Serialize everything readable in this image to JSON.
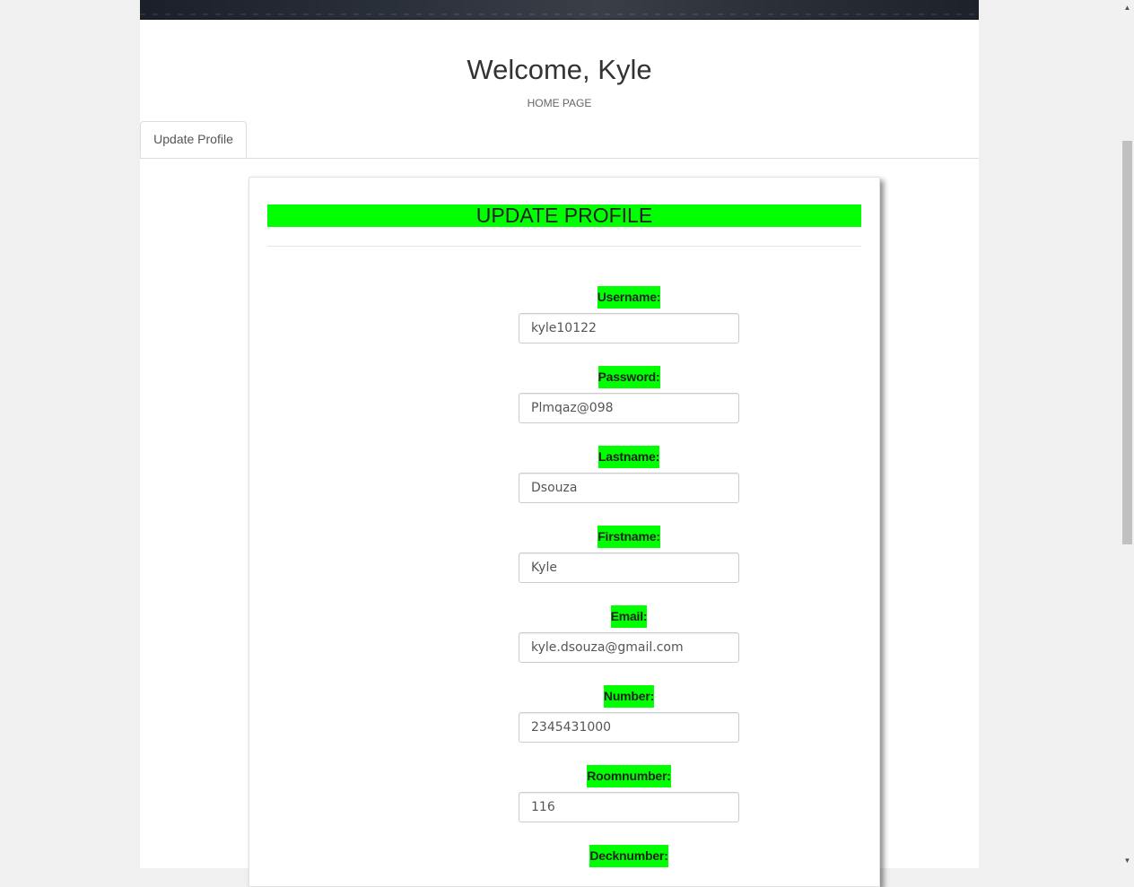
{
  "header": {
    "welcome": "Welcome, Kyle",
    "subtitle": "HOME PAGE"
  },
  "tabs": [
    {
      "label": "Update Profile",
      "active": true
    }
  ],
  "form": {
    "title": "UPDATE PROFILE",
    "fields": [
      {
        "label": "Username:",
        "value": "kyle10122"
      },
      {
        "label": "Password:",
        "value": "Plmqaz@098"
      },
      {
        "label": "Lastname:",
        "value": "Dsouza"
      },
      {
        "label": "Firstname:",
        "value": "Kyle"
      },
      {
        "label": "Email:",
        "value": "kyle.dsouza@gmail.com"
      },
      {
        "label": "Number:",
        "value": "2345431000"
      },
      {
        "label": "Roomnumber:",
        "value": "116"
      },
      {
        "label": "Decknumber:",
        "value": ""
      }
    ]
  },
  "colors": {
    "highlight": "#00ff00",
    "page_background": "#f0f0f0",
    "text": "#333333"
  },
  "scrollbar": {
    "up_icon": "triangle-up-icon",
    "down_icon": "triangle-down-icon"
  }
}
